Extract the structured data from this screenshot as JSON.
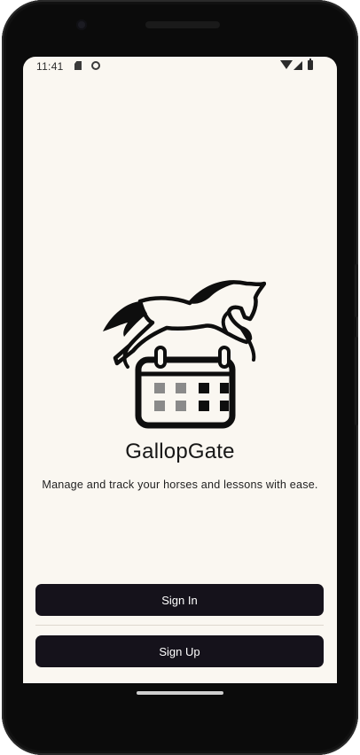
{
  "status_bar": {
    "time": "11:41",
    "icons": [
      "sd-card-icon",
      "app-notification-icon",
      "wifi-icon",
      "signal-icon",
      "battery-icon"
    ]
  },
  "app": {
    "logo_icon": "horse-jumping-calendar-icon",
    "title": "GallopGate",
    "tagline": "Manage and track your horses and lessons with ease."
  },
  "actions": {
    "sign_in_label": "Sign In",
    "sign_up_label": "Sign Up"
  },
  "colors": {
    "background": "#faf7f1",
    "button": "#15121b",
    "button_text": "#ffffff",
    "text": "#171717"
  }
}
